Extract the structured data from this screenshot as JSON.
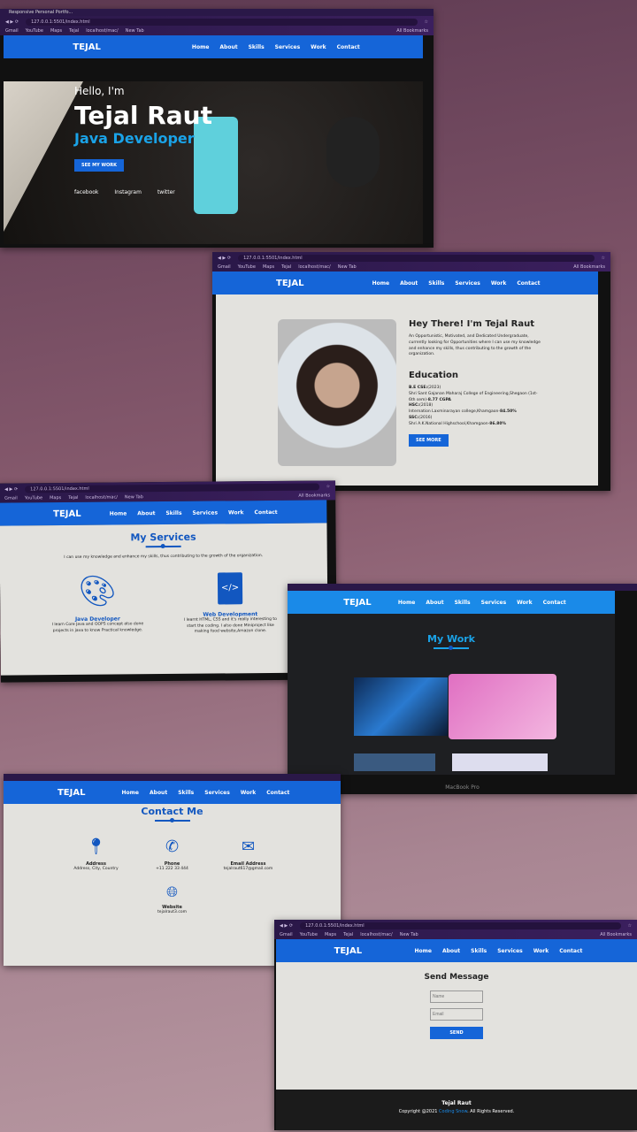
{
  "browser": {
    "tab": "Responsive Personal Portfo...",
    "url": "127.0.0.1:5501/index.html",
    "bookmarks": [
      "Gmail",
      "YouTube",
      "Maps",
      "Tejal",
      "localhost/mac/",
      "New Tab"
    ],
    "all_bookmarks": "All Bookmarks"
  },
  "nav": {
    "logo": "TEJAL",
    "links": [
      "Home",
      "About",
      "Skills",
      "Services",
      "Work",
      "Contact"
    ]
  },
  "hero": {
    "greeting": "Hello, I'm",
    "name": "Tejal Raut",
    "role": "Java Developer",
    "button": "SEE MY WORK",
    "socials": [
      "facebook",
      "Instagram",
      "twitter"
    ]
  },
  "about": {
    "title": "Hey There! I'm Tejal Raut",
    "intro": "An Opportunistic, Motivated, and Dedicated Undergraduate, currently looking for Opportunities where I can use my knowledge and enhance my skills, thus contributing to the growth of the organization.",
    "edu_title": "Education",
    "education": [
      {
        "deg": "B.E CSE:",
        "year": "(2023)",
        "detail": "Shri Sant Gajanan Maharaj College of Engineering,Shegaon (1st-6th sem)-",
        "score": "8.77 CGPA"
      },
      {
        "deg": "HSC:",
        "year": "(2018)",
        "detail": "Internation Laxminarayan college,Khamgaon-",
        "score": "84.50%"
      },
      {
        "deg": "SSC:",
        "year": "(2016)",
        "detail": "Shri A.K.National Highschool,Khamgaon-",
        "score": "86.80%"
      }
    ],
    "button": "SEE MORE"
  },
  "services": {
    "title": "My Services",
    "subtitle": "I can use my knowledge and enhance my skills, thus contributing to the growth of the organization.",
    "items": [
      {
        "icon": "palette-icon",
        "name": "Java Developer",
        "desc": "I learn Core Java and OOPS concept also done projects in java to know Practical knowledge."
      },
      {
        "icon": "code-file-icon",
        "name": "Web Development",
        "desc": "I learnt HTML, CSS and it's really interesting to start the coding. I also done Miniproject like making food website,Amazon clone."
      }
    ]
  },
  "work": {
    "title": "My Work",
    "device_label": "MacBook Pro"
  },
  "contact": {
    "title": "Contact Me",
    "items": [
      {
        "icon": "map-pin-icon",
        "label": "Address",
        "value": "Address, City, Country"
      },
      {
        "icon": "phone-icon",
        "label": "Phone",
        "value": "+11 222 33 444"
      },
      {
        "icon": "envelope-icon",
        "label": "Email Address",
        "value": "tejalraut617@gmail.com"
      },
      {
        "icon": "globe-icon",
        "label": "Website",
        "value": "tejalraut3.com"
      }
    ]
  },
  "form": {
    "title": "Send Message",
    "name_placeholder": "Name",
    "email_placeholder": "Email",
    "button": "SEND"
  },
  "footer": {
    "name": "Tejal Raut",
    "copy_prefix": "Copyright @2021 ",
    "brand": "Coding Snow",
    "copy_suffix": ". All Rights Reserved."
  },
  "colors": {
    "primary": "#1565d8",
    "dark": "#1b1b1b",
    "bg": "#e3e2de"
  }
}
